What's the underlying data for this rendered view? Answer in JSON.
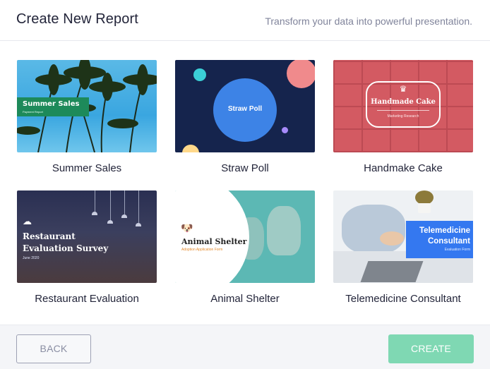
{
  "header": {
    "title": "Create New Report",
    "subtitle": "Transform your data into powerful presentation."
  },
  "templates": [
    {
      "label": "Summer Sales",
      "thumb_title": "Summer Sales",
      "thumb_sub": "Payment Report"
    },
    {
      "label": "Straw Poll",
      "thumb_title": "Straw Poll"
    },
    {
      "label": "Handmake Cake",
      "thumb_title": "Handmade Cake",
      "thumb_sub": "Marketing Research",
      "icon": "cake-icon"
    },
    {
      "label": "Restaurant Evaluation",
      "thumb_title_1": "Restaurant",
      "thumb_title_2": "Evaluation Survey",
      "thumb_sub": "June 2020",
      "icon": "chef-hat-icon"
    },
    {
      "label": "Animal Shelter",
      "thumb_title": "Animal Shelter",
      "thumb_sub": "Adoption Application Form",
      "icon": "dog-icon"
    },
    {
      "label": "Telemedicine Consultant",
      "thumb_title_1": "Telemedicine",
      "thumb_title_2": "Consultant",
      "thumb_sub": "Evaluation Form"
    }
  ],
  "footer": {
    "back_label": "BACK",
    "create_label": "CREATE"
  },
  "colors": {
    "accent_create": "#7fd8b3",
    "back_border": "#9da1b4"
  }
}
